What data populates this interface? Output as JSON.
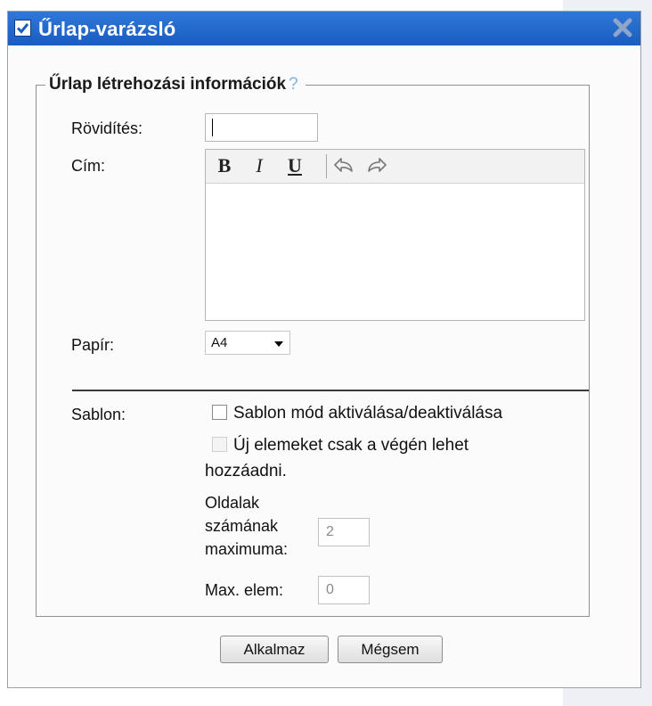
{
  "window": {
    "title": "Űrlap-varázsló"
  },
  "section": {
    "legend": "Űrlap létrehozási információk",
    "help": "?"
  },
  "fields": {
    "abbreviation_label": "Rövidítés:",
    "abbreviation_value": "",
    "title_label": "Cím:",
    "paper_label": "Papír:",
    "paper_value": "A4"
  },
  "toolbar": {
    "bold": "B",
    "italic": "I",
    "underline": "U",
    "icons": [
      "undo-icon",
      "redo-icon"
    ]
  },
  "template": {
    "label": "Sablon:",
    "toggle_label": "Sablon mód aktiválása/deaktiválása",
    "append_only_line1": "Új elemeket csak a végén lehet",
    "append_only_line2": "hozzáadni.",
    "max_pages_line1": "Oldalak",
    "max_pages_line2": "számának",
    "max_pages_line3": "maximuma:",
    "max_pages_value": "2",
    "max_elem_label": "Max. elem:",
    "max_elem_value": "0"
  },
  "buttons": {
    "apply": "Alkalmaz",
    "cancel": "Mégsem"
  },
  "colors": {
    "titlebar": "#1f66cc",
    "help": "#7fb4dd"
  }
}
